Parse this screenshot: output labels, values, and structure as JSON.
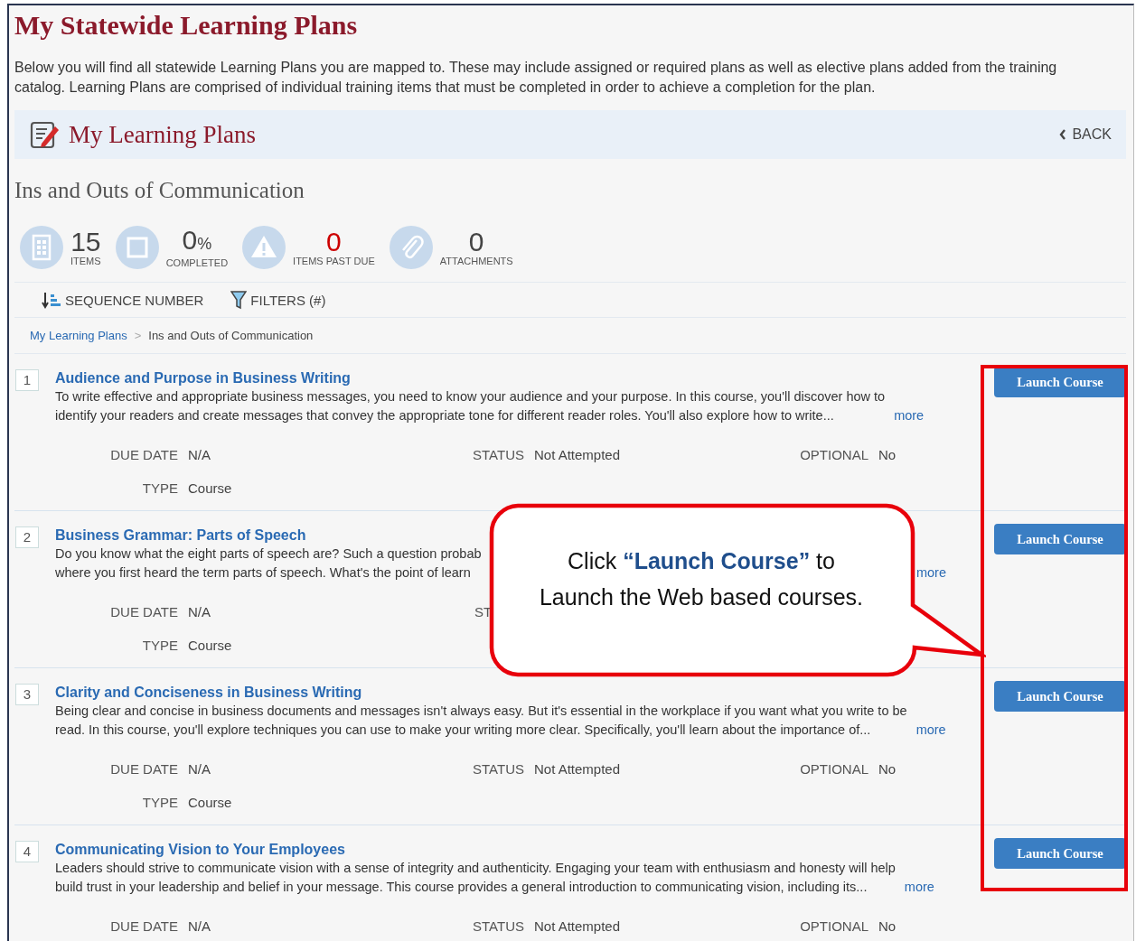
{
  "page": {
    "title": "My Statewide Learning Plans",
    "intro": "Below you will find all statewide Learning Plans you are mapped to. These may include assigned or required plans as well as elective plans added from the training catalog. Learning Plans are comprised of individual training items that must be completed in order to achieve a completion for the plan."
  },
  "header": {
    "title": "My Learning Plans",
    "back": "BACK"
  },
  "plan_title": "Ins and Outs of Communication",
  "stats": [
    {
      "kind": "items",
      "value": "15",
      "label": "ITEMS",
      "alert": false
    },
    {
      "kind": "completion",
      "value": "0",
      "unit": "%",
      "label": "COMPLETED",
      "alert": false
    },
    {
      "kind": "past_due",
      "value": "0",
      "label": "ITEMS PAST DUE",
      "alert": true
    },
    {
      "kind": "attachments",
      "value": "0",
      "label": "ATTACHMENTS",
      "alert": false
    }
  ],
  "toolbar": [
    {
      "kind": "sort",
      "label": "SEQUENCE NUMBER"
    },
    {
      "kind": "filter",
      "label": "FILTERS (#)"
    }
  ],
  "breadcrumb": {
    "separator": ">",
    "items": [
      {
        "label": "My Learning Plans",
        "link": true
      },
      {
        "label": "Ins and Outs of Communication",
        "link": false
      }
    ]
  },
  "items": [
    {
      "number": "1",
      "title": "Audience and Purpose in Business Writing",
      "lines": [
        "To write effective and appropriate business messages, you need to know your audience and your purpose. In this course, you'll discover how to",
        "identify your readers and create messages that convey the appropriate tone for different reader roles. You'll also explore how to write..."
      ],
      "more": "more",
      "covered": false,
      "button": "Launch Course",
      "meta": [
        [
          {
            "label": "DUE DATE",
            "value": "N/A"
          },
          {
            "label": "STATUS",
            "value": "Not Attempted"
          },
          {
            "label": "OPTIONAL",
            "value": "No"
          }
        ],
        [
          {
            "label": "TYPE",
            "value": "Course"
          }
        ]
      ]
    },
    {
      "number": "2",
      "title": "Business Grammar: Parts of Speech",
      "lines": [
        "Do you know what the eight parts of speech are? Such a question probab",
        "where you first heard the term parts of speech. What's the point of learn"
      ],
      "more": "more",
      "covered": true,
      "button": "Launch Course",
      "meta": [
        [
          {
            "label": "DUE DATE",
            "value": "N/A"
          },
          {
            "label": "ST"
          }
        ],
        [
          {
            "label": "TYPE",
            "value": "Course"
          }
        ]
      ]
    },
    {
      "number": "3",
      "title": "Clarity and Conciseness in Business Writing",
      "lines": [
        "Being clear and concise in business documents and messages isn't always easy. But it's essential in the workplace if you want what you write to be",
        "read. In this course, you'll explore techniques you can use to make your writing more clear. Specifically, you'll learn about the importance of..."
      ],
      "more": "more",
      "covered": false,
      "button": "Launch Course",
      "meta": [
        [
          {
            "label": "DUE DATE",
            "value": "N/A"
          },
          {
            "label": "STATUS",
            "value": "Not Attempted"
          },
          {
            "label": "OPTIONAL",
            "value": "No"
          }
        ],
        [
          {
            "label": "TYPE",
            "value": "Course"
          }
        ]
      ]
    },
    {
      "number": "4",
      "title": "Communicating Vision to Your Employees",
      "lines": [
        "Leaders should strive to communicate vision with a sense of integrity and authenticity. Engaging your team with enthusiasm and honesty will help",
        "build trust in your leadership and belief in your message. This course provides a general introduction to communicating vision, including its..."
      ],
      "more": "more",
      "covered": false,
      "button": "Launch Course",
      "meta": [
        [
          {
            "label": "DUE DATE",
            "value": "N/A"
          },
          {
            "label": "STATUS",
            "value": "Not Attempted"
          },
          {
            "label": "OPTIONAL",
            "value": "No"
          }
        ]
      ]
    }
  ],
  "callout": {
    "text": "Click **“Launch Course”** to Launch the Web based courses."
  }
}
